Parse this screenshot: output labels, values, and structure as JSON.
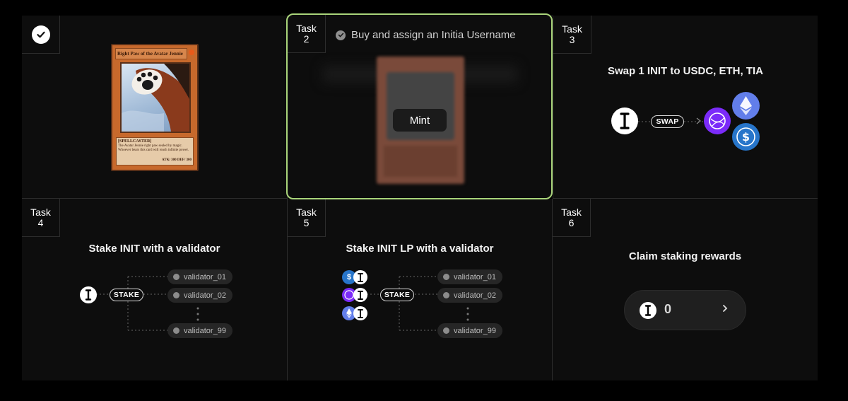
{
  "tasks": [
    {
      "id": 1,
      "completed": true
    },
    {
      "id": 2,
      "tag_word": "Task",
      "tag_num": "2",
      "title": "Buy and assign an Initia Username",
      "mint_label": "Mint",
      "completed": true
    },
    {
      "id": 3,
      "tag_word": "Task",
      "tag_num": "3",
      "title": "Swap 1 INIT to USDC, ETH, TIA",
      "swap_label": "SWAP"
    },
    {
      "id": 4,
      "tag_word": "Task",
      "tag_num": "4",
      "title": "Stake INIT with a validator",
      "stake_label": "STAKE"
    },
    {
      "id": 5,
      "tag_word": "Task",
      "tag_num": "5",
      "title": "Stake INIT LP with a validator",
      "stake_label": "STAKE"
    },
    {
      "id": 6,
      "tag_word": "Task",
      "tag_num": "6",
      "title": "Claim staking rewards",
      "rewards_value": "0"
    }
  ],
  "card": {
    "name": "Right Paw of the Avatar Jennie",
    "type_line": "[SPELLCASTER]",
    "description": "The Avatar Jennie right paw sealed by magic. Whoever bears this card will reach infinite power.",
    "stats": "ATK/ 300  DEF/ 300"
  },
  "validators": [
    "validator_01",
    "validator_02",
    "validator_99"
  ],
  "colors": {
    "accent_border": "#a9d47a",
    "panel": "#0d0d0d",
    "divider": "#2c2c2c",
    "usdc": "#2775ca",
    "eth": "#627eea",
    "tia": "#7b2bf9"
  },
  "icons": [
    "check-icon",
    "init-token-icon",
    "tia-token-icon",
    "eth-token-icon",
    "usdc-token-icon",
    "chevron-right-icon"
  ]
}
